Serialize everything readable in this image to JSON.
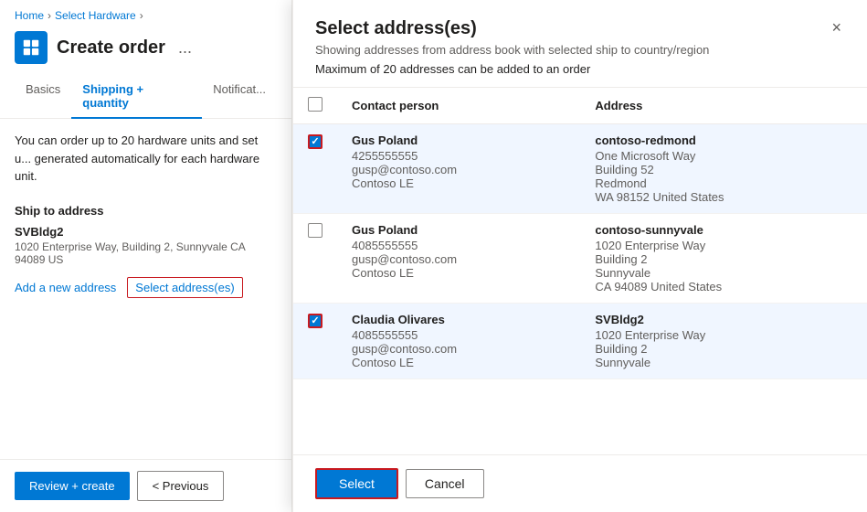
{
  "breadcrumb": {
    "items": [
      {
        "label": "Home",
        "active": false
      },
      {
        "label": "Select Hardware",
        "active": true
      }
    ]
  },
  "order": {
    "title": "Create order",
    "more_label": "...",
    "icon_symbol": "📦"
  },
  "tabs": [
    {
      "label": "Basics",
      "active": false
    },
    {
      "label": "Shipping + quantity",
      "active": true
    },
    {
      "label": "Notificat...",
      "active": false
    }
  ],
  "left_panel": {
    "info_text": "You can order up to 20 hardware units and set u... generated automatically for each hardware unit.",
    "ship_to_label": "Ship to address",
    "address": {
      "name": "SVBldg2",
      "detail": "1020 Enterprise Way, Building 2, Sunnyvale CA 94089 US"
    },
    "add_link": "Add a new address",
    "select_link": "Select address(es)"
  },
  "footer": {
    "review_label": "Review + create",
    "previous_label": "< Previous"
  },
  "modal": {
    "title": "Select address(es)",
    "subtitle": "Showing addresses from address book with selected ship to country/region",
    "note": "Maximum of 20 addresses can be added to an order",
    "close_label": "×",
    "columns": {
      "contact": "Contact person",
      "address": "Address"
    },
    "rows": [
      {
        "checked": true,
        "red_border": true,
        "contact_name": "Gus Poland",
        "phone": "4255555555",
        "email": "gusp@contoso.com",
        "company": "Contoso LE",
        "addr_name": "contoso-redmond",
        "addr_line1": "One Microsoft Way",
        "addr_line2": "Building 52",
        "addr_city": "Redmond",
        "addr_region": "WA 98152 United States"
      },
      {
        "checked": false,
        "red_border": false,
        "contact_name": "Gus Poland",
        "phone": "4085555555",
        "email": "gusp@contoso.com",
        "company": "Contoso LE",
        "addr_name": "contoso-sunnyvale",
        "addr_line1": "1020 Enterprise Way",
        "addr_line2": "Building 2",
        "addr_city": "Sunnyvale",
        "addr_region": "CA 94089 United States"
      },
      {
        "checked": true,
        "red_border": true,
        "contact_name": "Claudia Olivares",
        "phone": "4085555555",
        "email": "gusp@contoso.com",
        "company": "Contoso LE",
        "addr_name": "SVBldg2",
        "addr_line1": "1020 Enterprise Way",
        "addr_line2": "Building 2",
        "addr_city": "Sunnyvale",
        "addr_region": ""
      }
    ],
    "select_button": "Select",
    "cancel_button": "Cancel"
  }
}
